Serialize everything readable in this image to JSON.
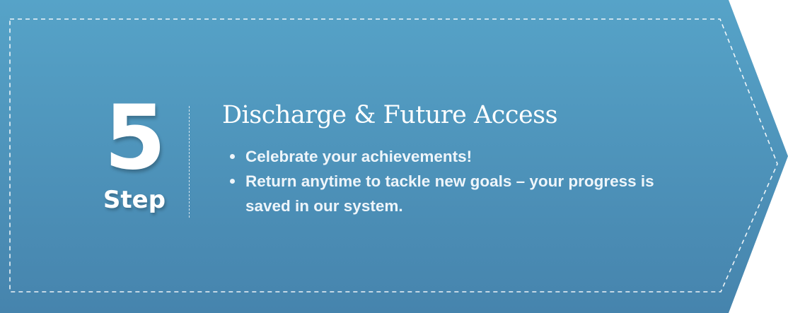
{
  "step": {
    "number": "5",
    "label": "Step"
  },
  "title": "Discharge & Future Access",
  "bullets": [
    "Celebrate your achievements!",
    "Return anytime to tackle new goals – your progress is saved in our system."
  ],
  "colors": {
    "gradient_top": "#56a3c8",
    "gradient_bottom": "#4684ad",
    "text": "#ffffff",
    "dashed_border": "#ffffff"
  }
}
